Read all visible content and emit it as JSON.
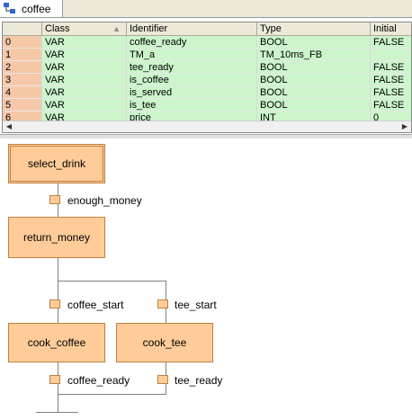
{
  "tab": {
    "label": "coffee",
    "icon": "sfc-diagram-icon"
  },
  "grid": {
    "columns": [
      "",
      "Class",
      "Identifier",
      "Type",
      "Initial"
    ],
    "rows": [
      {
        "num": "0",
        "class": "VAR",
        "identifier": "coffee_ready",
        "type": "BOOL",
        "initial": "FALSE"
      },
      {
        "num": "1",
        "class": "VAR",
        "identifier": "TM_a",
        "type": "TM_10ms_FB",
        "initial": ""
      },
      {
        "num": "2",
        "class": "VAR",
        "identifier": "tee_ready",
        "type": "BOOL",
        "initial": "FALSE"
      },
      {
        "num": "3",
        "class": "VAR",
        "identifier": "is_coffee",
        "type": "BOOL",
        "initial": "FALSE"
      },
      {
        "num": "4",
        "class": "VAR",
        "identifier": "is_served",
        "type": "BOOL",
        "initial": "FALSE"
      },
      {
        "num": "5",
        "class": "VAR",
        "identifier": "is_tee",
        "type": "BOOL",
        "initial": "FALSE"
      },
      {
        "num": "6",
        "class": "VAR",
        "identifier": "price",
        "type": "INT",
        "initial": "0"
      }
    ]
  },
  "sfc": {
    "steps": {
      "select_drink": "select_drink",
      "return_money": "return_money",
      "cook_coffee": "cook_coffee",
      "cook_tee": "cook_tee"
    },
    "transitions": {
      "enough_money": "enough_money",
      "coffee_start": "coffee_start",
      "tee_start": "tee_start",
      "coffee_ready": "coffee_ready",
      "tee_ready": "tee_ready"
    }
  }
}
